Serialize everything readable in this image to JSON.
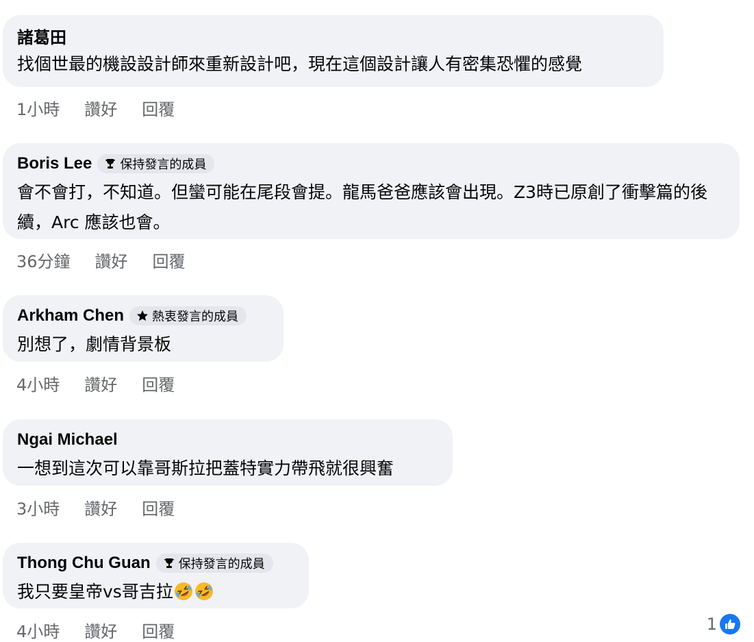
{
  "comments": [
    {
      "author": "諸葛田",
      "badge": "",
      "text": "找個世最的機設設計師來重新設計吧，現在這個設計讓人有密集恐懼的感覺",
      "time": "1小時",
      "like": "讚好",
      "reply": "回覆"
    },
    {
      "author": "Boris Lee",
      "badge": "保持發言的成員",
      "badge_icon": "trophy-icon",
      "text": "會不會打，不知道。但蠻可能在尾段會提。龍馬爸爸應該會出現。Z3時已原創了衝擊篇的後續，Arc 應該也會。",
      "time": "36分鐘",
      "like": "讚好",
      "reply": "回覆"
    },
    {
      "author": "Arkham Chen",
      "badge": "熱衷發言的成員",
      "badge_icon": "star-icon",
      "text": "別想了，劇情背景板",
      "time": "4小時",
      "like": "讚好",
      "reply": "回覆"
    },
    {
      "author": "Ngai Michael",
      "badge": "",
      "text": "一想到這次可以靠哥斯拉把蓋特實力帶飛就很興奮",
      "time": "3小時",
      "like": "讚好",
      "reply": "回覆"
    },
    {
      "author": "Thong Chu Guan",
      "badge": "保持發言的成員",
      "badge_icon": "trophy-icon",
      "text": "我只要皇帝vs哥吉拉",
      "emojis": [
        "rolling-laughing-emoji",
        "rolling-laughing-emoji"
      ],
      "time": "4小時",
      "like": "讚好",
      "reply": "回覆"
    }
  ],
  "reaction": {
    "count": "1",
    "icon": "like-icon",
    "color": "#1877f2"
  },
  "colors": {
    "bubble": "#f0f2f5",
    "badge": "#e4e6eb",
    "meta_text": "#65676b",
    "text": "#050505"
  }
}
